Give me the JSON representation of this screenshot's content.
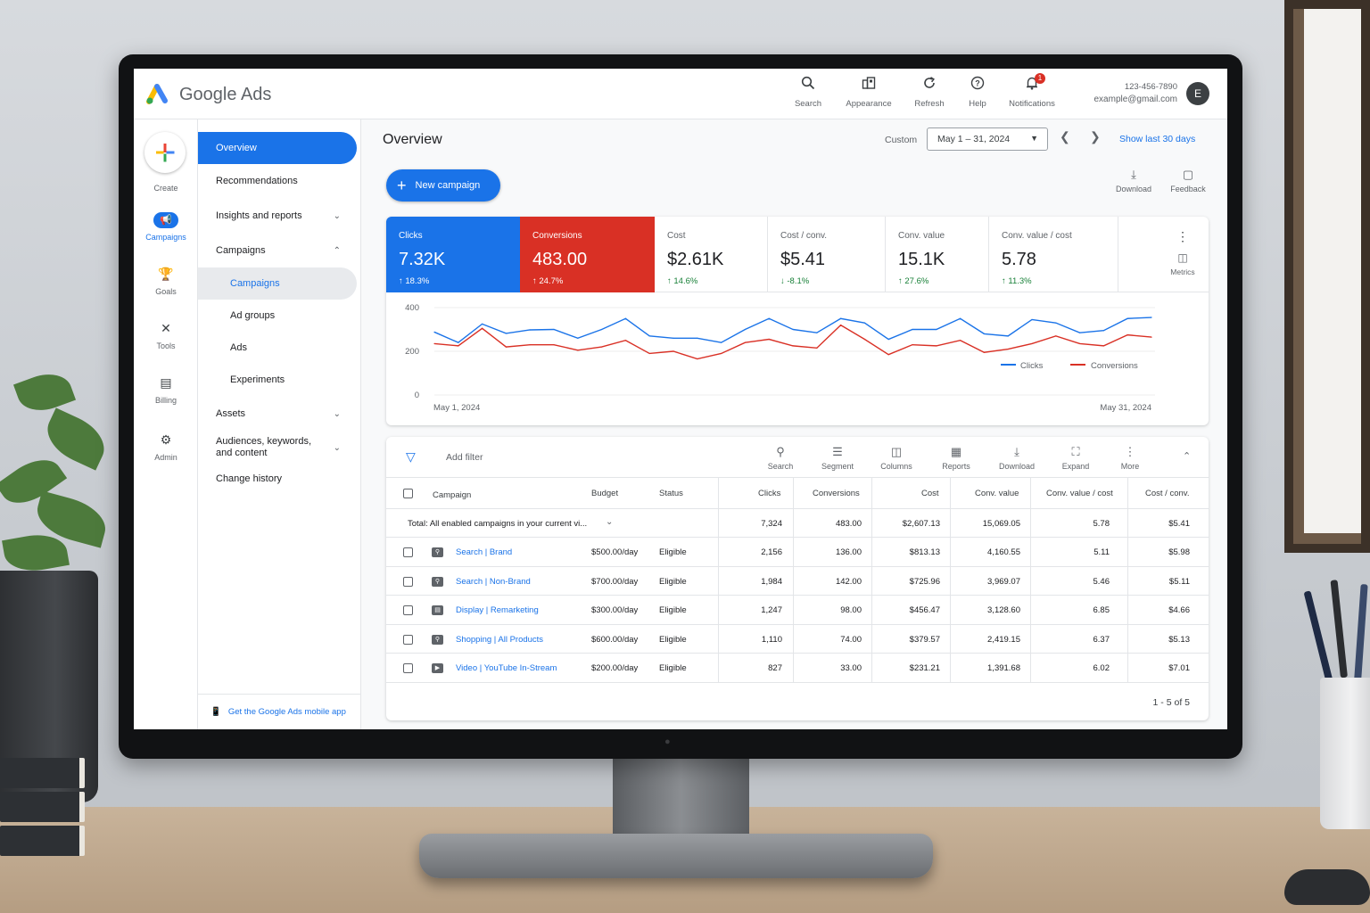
{
  "app": {
    "name": "Google Ads"
  },
  "topbar": {
    "actions": [
      {
        "label": "Search",
        "icon": "search-icon"
      },
      {
        "label": "Appearance",
        "icon": "appearance-icon"
      },
      {
        "label": "Refresh",
        "icon": "refresh-icon"
      },
      {
        "label": "Help",
        "icon": "help-icon"
      },
      {
        "label": "Notifications",
        "icon": "bell-icon",
        "badge": "1"
      }
    ],
    "account": {
      "id": "123-456-7890",
      "email": "example@gmail.com",
      "avatar_initial": "E"
    }
  },
  "rail": {
    "create_label": "Create",
    "items": [
      {
        "label": "Campaigns",
        "icon": "campaigns-icon",
        "active": true
      },
      {
        "label": "Goals",
        "icon": "trophy-icon"
      },
      {
        "label": "Tools",
        "icon": "tools-icon"
      },
      {
        "label": "Billing",
        "icon": "billing-icon"
      },
      {
        "label": "Admin",
        "icon": "gear-icon"
      }
    ]
  },
  "nav": {
    "items": [
      {
        "label": "Overview"
      },
      {
        "label": "Recommendations"
      },
      {
        "label": "Insights and reports"
      },
      {
        "label": "Campaigns"
      },
      {
        "label": "Campaigns"
      },
      {
        "label": "Ad groups"
      },
      {
        "label": "Ads"
      },
      {
        "label": "Experiments"
      },
      {
        "label": "Assets"
      },
      {
        "label": "Audiences, keywords, and content"
      },
      {
        "label": "Change history"
      }
    ],
    "footer": "Get the Google Ads mobile app"
  },
  "main": {
    "title": "Overview",
    "date": {
      "custom_label": "Custom",
      "range": "May 1 – 31, 2024",
      "show_last": "Show last 30 days"
    },
    "new_campaign_label": "New campaign",
    "actions": [
      {
        "label": "Download"
      },
      {
        "label": "Feedback"
      }
    ]
  },
  "scorecards": [
    {
      "name": "Clicks",
      "value": "7.32K",
      "delta": "↑ 18.3%"
    },
    {
      "name": "Conversions",
      "value": "483.00",
      "delta": "↑ 24.7%"
    },
    {
      "name": "Cost",
      "value": "$2.61K",
      "delta": "↑ 14.6%"
    },
    {
      "name": "Cost / conv.",
      "value": "$5.41",
      "delta": "↓ -8.1%"
    },
    {
      "name": "Conv. value",
      "value": "15.1K",
      "delta": "↑ 27.6%"
    },
    {
      "name": "Conv. value / cost",
      "value": "5.78",
      "delta": "↑ 11.3%"
    }
  ],
  "metrics_label": "Metrics",
  "chart_data": {
    "type": "line",
    "ylim": [
      0,
      400
    ],
    "yticks": [
      "0",
      "200",
      "400"
    ],
    "x_start_label": "May 1, 2024",
    "x_end_label": "May 31, 2024",
    "grid": true,
    "legend_position": "bottom-right",
    "series": [
      {
        "name": "Clicks",
        "color": "#1a73e8",
        "values": [
          288,
          240,
          325,
          282,
          298,
          300,
          260,
          300,
          350,
          270,
          260,
          260,
          240,
          300,
          350,
          300,
          285,
          350,
          330,
          255,
          300,
          300,
          350,
          280,
          270,
          345,
          330,
          285,
          295,
          350,
          355
        ]
      },
      {
        "name": "Conversions",
        "color": "#d93025",
        "values": [
          235,
          225,
          305,
          220,
          230,
          230,
          205,
          220,
          250,
          190,
          200,
          165,
          190,
          240,
          255,
          225,
          215,
          320,
          255,
          185,
          230,
          225,
          250,
          195,
          210,
          235,
          270,
          235,
          225,
          275,
          265
        ]
      }
    ]
  },
  "table": {
    "filter_placeholder": "Add filter",
    "tools": [
      {
        "label": "Search",
        "icon": "search-icon"
      },
      {
        "label": "Segment",
        "icon": "segment-icon"
      },
      {
        "label": "Columns",
        "icon": "columns-icon"
      },
      {
        "label": "Reports",
        "icon": "reports-icon"
      },
      {
        "label": "Download",
        "icon": "download-icon"
      },
      {
        "label": "Expand",
        "icon": "expand-icon"
      },
      {
        "label": "More",
        "icon": "more-icon"
      }
    ],
    "headers": [
      "Campaign",
      "Budget",
      "Status",
      "Clicks",
      "Conversions",
      "Cost",
      "Conv. value",
      "Conv. value / cost",
      "Cost / conv."
    ],
    "total": {
      "label": "Total: All enabled campaigns in your current vi...",
      "clicks": "7,324",
      "conversions": "483.00",
      "cost": "$2,607.13",
      "conv_value": "15,069.05",
      "value_cost": "5.78",
      "cost_conv": "$5.41"
    },
    "rows": [
      {
        "type_icon": "search-campaign-icon",
        "name": "Search | Brand",
        "budget": "$500.00/day",
        "status": "Eligible",
        "clicks": "2,156",
        "conversions": "136.00",
        "cost": "$813.13",
        "conv_value": "4,160.55",
        "value_cost": "5.11",
        "cost_conv": "$5.98"
      },
      {
        "type_icon": "search-campaign-icon",
        "name": "Search | Non-Brand",
        "budget": "$700.00/day",
        "status": "Eligible",
        "clicks": "1,984",
        "conversions": "142.00",
        "cost": "$725.96",
        "conv_value": "3,969.07",
        "value_cost": "5.46",
        "cost_conv": "$5.11"
      },
      {
        "type_icon": "display-campaign-icon",
        "name": "Display | Remarketing",
        "budget": "$300.00/day",
        "status": "Eligible",
        "clicks": "1,247",
        "conversions": "98.00",
        "cost": "$456.47",
        "conv_value": "3,128.60",
        "value_cost": "6.85",
        "cost_conv": "$4.66"
      },
      {
        "type_icon": "shopping-campaign-icon",
        "name": "Shopping | All Products",
        "budget": "$600.00/day",
        "status": "Eligible",
        "clicks": "1,110",
        "conversions": "74.00",
        "cost": "$379.57",
        "conv_value": "2,419.15",
        "value_cost": "6.37",
        "cost_conv": "$5.13"
      },
      {
        "type_icon": "video-campaign-icon",
        "name": "Video | YouTube In-Stream",
        "budget": "$200.00/day",
        "status": "Eligible",
        "clicks": "827",
        "conversions": "33.00",
        "cost": "$231.21",
        "conv_value": "1,391.68",
        "value_cost": "6.02",
        "cost_conv": "$7.01"
      }
    ],
    "pagination": "1 - 5 of 5"
  },
  "colors": {
    "accent": "#1a73e8",
    "conversions": "#d93025",
    "positive": "#188038"
  }
}
